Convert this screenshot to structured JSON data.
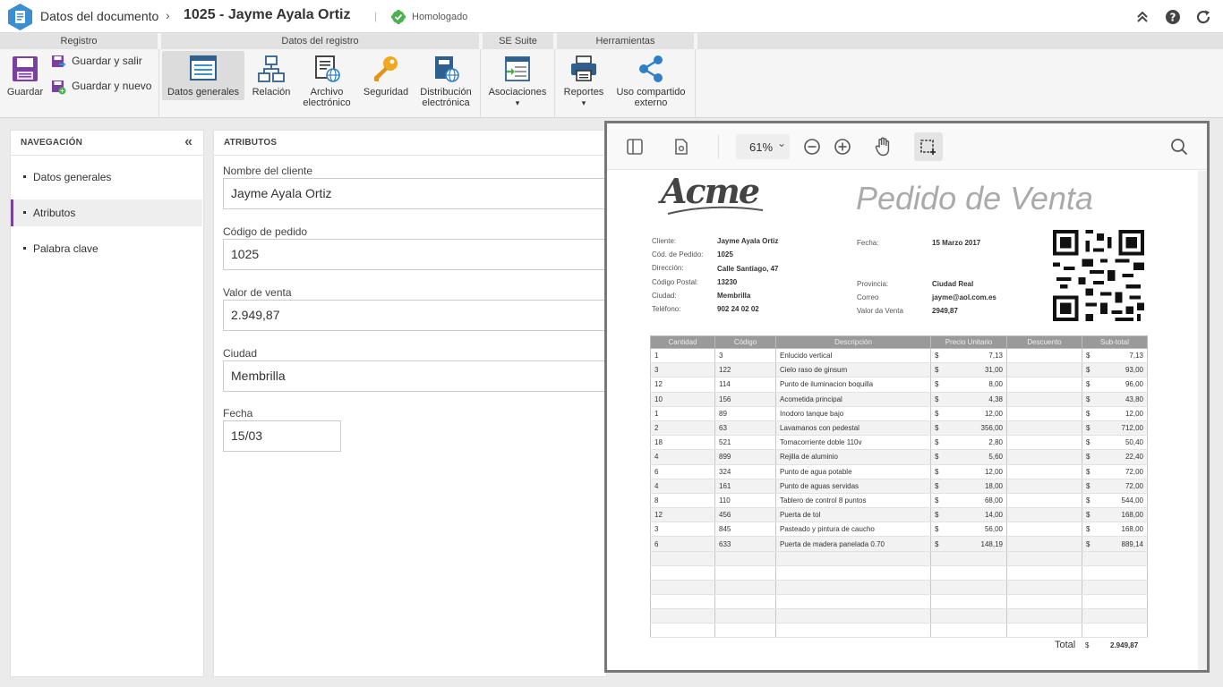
{
  "header": {
    "breadcrumb": "Datos del documento",
    "breadcrumb_sep": "›",
    "title": "1025 - Jayme Ayala Ortiz",
    "separator": "|",
    "status": "Homologado",
    "status_color": "#4caf50",
    "accent": "#3b8ed0",
    "right_icons": [
      "double-chevron-up-icon",
      "help-icon",
      "refresh-icon"
    ]
  },
  "ribbon": {
    "groups": [
      {
        "label": "Registro"
      },
      {
        "label": "Datos del registro"
      },
      {
        "label": "SE Suite"
      },
      {
        "label": "Herramientas"
      }
    ],
    "guardar": "Guardar",
    "guardar_salir": "Guardar y salir",
    "guardar_nuevo": "Guardar y nuevo",
    "datos_generales": "Datos generales",
    "relacion": "Relación",
    "archivo_1": "Archivo",
    "archivo_2": "electrónico",
    "seguridad": "Seguridad",
    "distribucion_1": "Distribución",
    "distribucion_2": "electrónica",
    "asociaciones": "Asociaciones",
    "reportes": "Reportes",
    "uso_1": "Uso compartido",
    "uso_2": "externo",
    "caret": "▾"
  },
  "nav": {
    "title": "NAVEGACIÓN",
    "collapse": "«",
    "items": [
      {
        "label": "Datos generales"
      },
      {
        "label": "Atributos"
      },
      {
        "label": "Palabra clave"
      }
    ]
  },
  "attributes": {
    "title": "ATRIBUTOS",
    "fields": [
      {
        "label": "Nombre del cliente",
        "value": "Jayme Ayala Ortiz"
      },
      {
        "label": "Código de pedido",
        "value": "1025"
      },
      {
        "label": "Valor de venta",
        "value": "2.949,87"
      },
      {
        "label": "Ciudad",
        "value": "Membrilla"
      },
      {
        "label": "Fecha",
        "value": "15/03"
      }
    ]
  },
  "viewer": {
    "zoom": "61%",
    "zoom_caret": "⌄",
    "tools": [
      "sidebar-toggle-icon",
      "page-settings-icon",
      "zoom-out-icon",
      "zoom-in-icon",
      "hand-tool-icon",
      "area-select-icon",
      "search-icon"
    ]
  },
  "invoice": {
    "logo": "Acme",
    "title": "Pedido de Venta",
    "left_fields": [
      {
        "label": "Cliente:",
        "value": "Jayme Ayala Ortiz"
      },
      {
        "label": "Cód. de Pedido:",
        "value": "1025"
      },
      {
        "label": "Dirección:",
        "value": "Calle Santiago, 47"
      },
      {
        "label": "Código Postal:",
        "value": "13230"
      },
      {
        "label": "Ciudad:",
        "value": "Membrilla"
      },
      {
        "label": "Teléfono:",
        "value": "902 24 02 02"
      }
    ],
    "fecha_label": "Fecha:",
    "fecha_value": "15 Marzo 2017",
    "right_fields": [
      {
        "label": "Provincia:",
        "value": "Ciudad Real"
      },
      {
        "label": "Correo",
        "value": "jayme@aol.com.es"
      },
      {
        "label": "Valor da Venta",
        "value": "2949,87"
      }
    ],
    "columns": [
      "Cantidad",
      "Código",
      "Descripción",
      "Precio Unitario",
      "Descuento",
      "Sub-total"
    ],
    "currency": "$",
    "rows": [
      {
        "qty": "1",
        "code": "3",
        "desc": "Enlucido vertical",
        "price": "7,13",
        "sub": "7,13"
      },
      {
        "qty": "3",
        "code": "122",
        "desc": "Cielo raso de ginsum",
        "price": "31,00",
        "sub": "93,00"
      },
      {
        "qty": "12",
        "code": "114",
        "desc": "Punto de iluminacion boquilla",
        "price": "8,00",
        "sub": "96,00"
      },
      {
        "qty": "10",
        "code": "156",
        "desc": "Acometida principal",
        "price": "4,38",
        "sub": "43,80"
      },
      {
        "qty": "1",
        "code": "89",
        "desc": "Inodoro tanque bajo",
        "price": "12,00",
        "sub": "12,00"
      },
      {
        "qty": "2",
        "code": "63",
        "desc": "Lavamanos con pedestal",
        "price": "356,00",
        "sub": "712,00"
      },
      {
        "qty": "18",
        "code": "521",
        "desc": "Tomacorriente doble 110v",
        "price": "2,80",
        "sub": "50,40"
      },
      {
        "qty": "4",
        "code": "899",
        "desc": "Rejilla de aluminio",
        "price": "5,60",
        "sub": "22,40"
      },
      {
        "qty": "6",
        "code": "324",
        "desc": "Punto de agua potable",
        "price": "12,00",
        "sub": "72,00"
      },
      {
        "qty": "4",
        "code": "161",
        "desc": "Punto de aguas servidas",
        "price": "18,00",
        "sub": "72,00"
      },
      {
        "qty": "8",
        "code": "110",
        "desc": "Tablero de control 8 puntos",
        "price": "68,00",
        "sub": "544,00"
      },
      {
        "qty": "12",
        "code": "456",
        "desc": "Puerta de tol",
        "price": "14,00",
        "sub": "168,00"
      },
      {
        "qty": "3",
        "code": "845",
        "desc": "Pasteado y pintura de caucho",
        "price": "56,00",
        "sub": "168,00"
      },
      {
        "qty": "6",
        "code": "633",
        "desc": "Puerta de madera panelada 0.70",
        "price": "148,19",
        "sub": "889,14"
      }
    ],
    "total_label": "Total",
    "total_value": "2.949,87"
  }
}
